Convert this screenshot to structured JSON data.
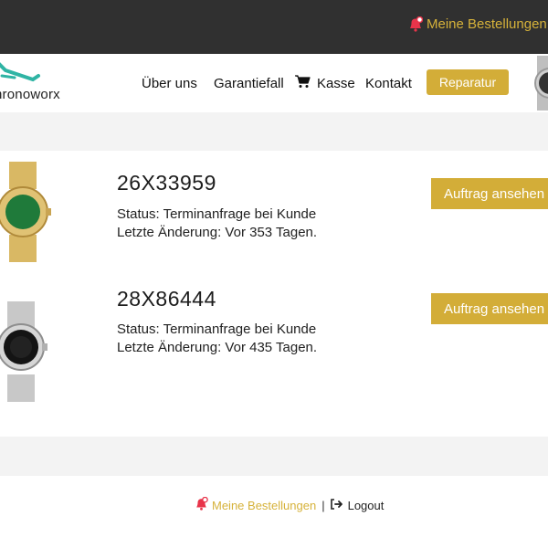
{
  "topbar": {
    "orders_label": "Meine Bestellungen",
    "bell_icon": "bell-icon"
  },
  "header": {
    "logo_text": "hronoworx",
    "nav": {
      "about": "Über uns",
      "warranty": "Garantiefall",
      "checkout": "Kasse",
      "contact": "Kontakt"
    },
    "repair_button": "Reparatur"
  },
  "orders": [
    {
      "id": "26X33959",
      "status": "Status: Terminanfrage bei Kunde",
      "last_change": "Letzte Änderung: Vor 353 Tagen.",
      "button": "Auftrag ansehen",
      "watch": "gold-green-dial-watch"
    },
    {
      "id": "28X86444",
      "status": "Status: Terminanfrage bei Kunde",
      "last_change": "Letzte Änderung: Vor 435 Tagen.",
      "button": "Auftrag ansehen",
      "watch": "steel-black-dial-watch"
    }
  ],
  "footer": {
    "orders_label": "Meine Bestellungen",
    "separator": "|",
    "logout_label": "Logout"
  },
  "colors": {
    "accent": "#d3ad38",
    "topbar": "#303030",
    "bell": "#e8344a",
    "band": "#f3f3f3"
  }
}
